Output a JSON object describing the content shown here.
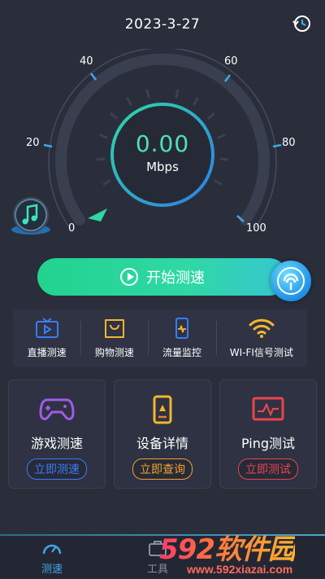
{
  "header": {
    "date": "2023-3-27",
    "history_icon": "history-clock-icon"
  },
  "gauge": {
    "tick_labels": [
      "0",
      "20",
      "40",
      "60",
      "80",
      "100"
    ],
    "value": "0.00",
    "unit": "Mbps",
    "level_fraction": 0,
    "accent_color": "#4fe0b4"
  },
  "music_button": {
    "icon": "music-note-icon"
  },
  "start_button": {
    "label": "开始测速",
    "icon": "play-circle-icon"
  },
  "wifi_button": {
    "icon": "wifi-signal-icon"
  },
  "tools": [
    {
      "label": "直播测速",
      "icon": "tv-icon",
      "color": "#3b7cf6"
    },
    {
      "label": "购物测速",
      "icon": "shopping-bag-icon",
      "color": "#f3b62c"
    },
    {
      "label": "流量监控",
      "icon": "phone-monitor-icon",
      "color": "#3b7cf6"
    },
    {
      "label": "WI-FI信号测试",
      "icon": "wifi-icon",
      "color": "#f3b62c"
    }
  ],
  "cards": [
    {
      "title": "游戏测速",
      "action": "立即测速",
      "icon": "gamepad-icon",
      "color": "#a25be6",
      "pill_color": "#3b7cf6"
    },
    {
      "title": "设备详情",
      "action": "立即查询",
      "icon": "device-icon",
      "color": "#f3b62c",
      "pill_color": "#f3a12c"
    },
    {
      "title": "Ping测试",
      "action": "立即测试",
      "icon": "ping-chart-icon",
      "color": "#e8454d",
      "pill_color": "#e8454d"
    }
  ],
  "bottom_nav": {
    "items": [
      {
        "label": "测速",
        "icon": "speedometer-icon",
        "active": true
      },
      {
        "label": "工具",
        "icon": "toolbox-icon",
        "active": false
      }
    ]
  },
  "watermark": {
    "logo": "592软件园",
    "url": "www.592xiazai.com"
  }
}
